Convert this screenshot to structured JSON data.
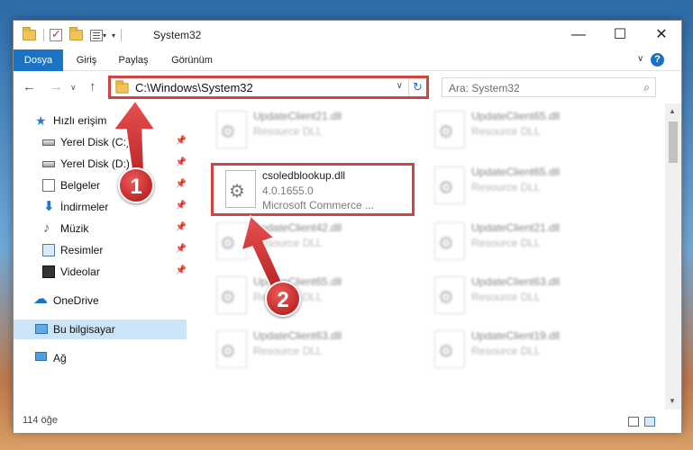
{
  "window": {
    "title": "System32",
    "minimize_glyph": "—",
    "maximize_glyph": "☐",
    "close_glyph": "✕"
  },
  "ribbon": {
    "tabs": [
      "Dosya",
      "Giriş",
      "Paylaş",
      "Görünüm"
    ],
    "help_glyph": "?",
    "collapse_glyph": "∨"
  },
  "nav": {
    "back_glyph": "←",
    "forward_glyph": "→",
    "recent_glyph": "∨",
    "up_glyph": "↑",
    "address": "C:\\Windows\\System32",
    "address_dropdown_glyph": "∨",
    "refresh_glyph": "↻",
    "search_placeholder": "Ara: System32",
    "search_glyph": "⌕"
  },
  "sidebar": {
    "items": [
      {
        "label": "Hızlı erişim",
        "icon": "star-icon"
      },
      {
        "label": "Yerel Disk (C:)",
        "icon": "drive-icon",
        "pinned": true
      },
      {
        "label": "Yerel Disk (D:)",
        "icon": "drive-icon",
        "pinned": true
      },
      {
        "label": "Belgeler",
        "icon": "documents-icon",
        "pinned": true
      },
      {
        "label": "İndirmeler",
        "icon": "download-icon",
        "pinned": true
      },
      {
        "label": "Müzik",
        "icon": "music-icon",
        "pinned": true
      },
      {
        "label": "Resimler",
        "icon": "pictures-icon",
        "pinned": true
      },
      {
        "label": "Videolar",
        "icon": "videos-icon",
        "pinned": true
      },
      {
        "label": "OneDrive",
        "icon": "onedrive-icon"
      },
      {
        "label": "Bu bilgisayar",
        "icon": "this-pc-icon",
        "selected": true
      },
      {
        "label": "Ağ",
        "icon": "network-icon"
      }
    ],
    "pin_glyph": "📌"
  },
  "files": {
    "left_column": [
      {
        "name": "UpdateClient21.dll",
        "type": "Resource DLL",
        "blurred": true
      },
      {
        "name": "csoledblookup.dll",
        "version": "4.0.1655.0",
        "company": "Microsoft Commerce ...",
        "highlighted": true
      },
      {
        "name": "UpdateClient42.dll",
        "type": "Resource DLL",
        "blurred": true
      },
      {
        "name": "UpdateClient65.dll",
        "type": "Resource DLL",
        "blurred": true
      },
      {
        "name": "UpdateClient63.dll",
        "type": "Resource DLL",
        "blurred": true
      }
    ],
    "right_column": [
      {
        "name": "UpdateClient65.dll",
        "type": "Resource DLL",
        "blurred": true
      },
      {
        "name": "UpdateClient65.dll",
        "type": "Resource DLL",
        "blurred": true
      },
      {
        "name": "UpdateClient21.dll",
        "type": "Resource DLL",
        "blurred": true
      },
      {
        "name": "UpdateClient63.dll",
        "type": "Resource DLL",
        "blurred": true
      },
      {
        "name": "UpdateClient19.dll",
        "type": "Resource DLL",
        "blurred": true
      }
    ]
  },
  "scrollbar": {
    "up_glyph": "▲",
    "down_glyph": "▼"
  },
  "status": {
    "item_count": "114 öğe"
  },
  "annotations": [
    {
      "label": "1",
      "color": "#d03a3a"
    },
    {
      "label": "2",
      "color": "#d03a3a"
    }
  ]
}
